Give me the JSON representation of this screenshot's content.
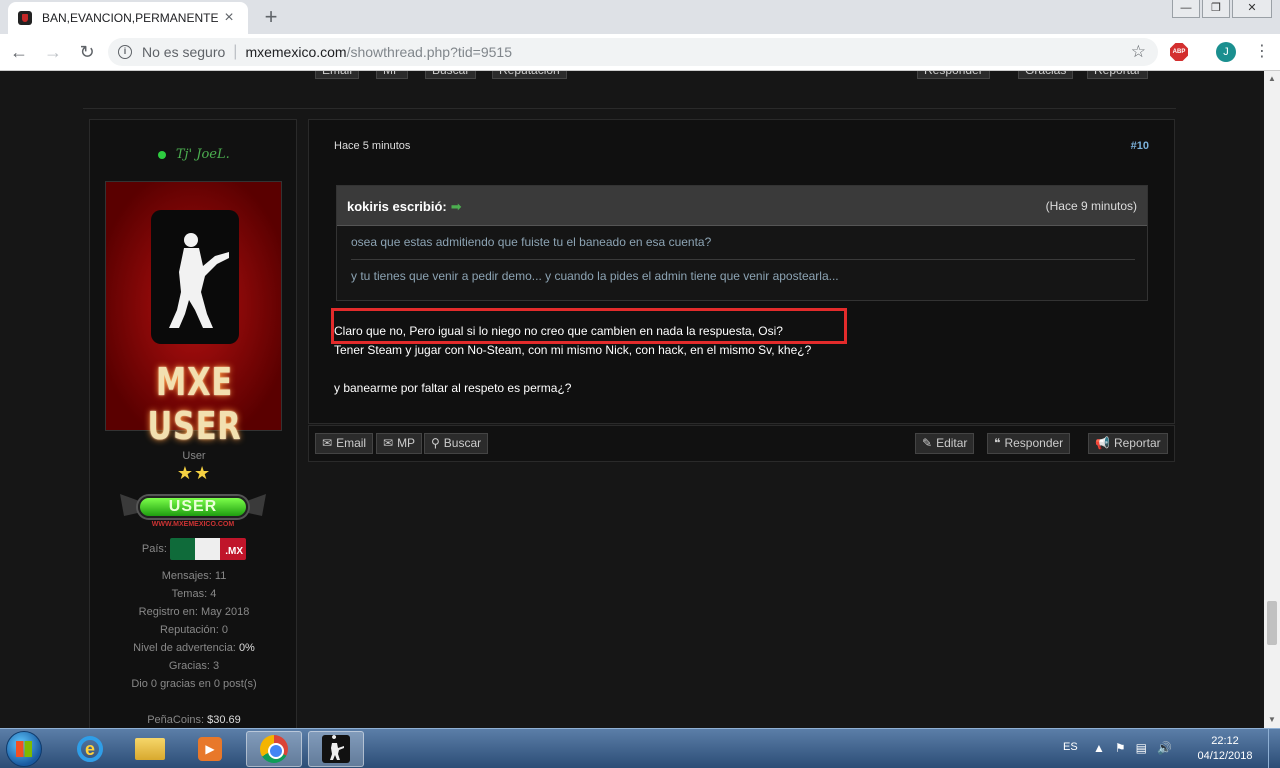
{
  "browser": {
    "tab_title": "BAN,EVANCION,PERMANENTE",
    "tab_close": "×",
    "new_tab": "+",
    "window_controls": {
      "minimize": "—",
      "maximize": "❐",
      "close": "✕"
    },
    "back": "←",
    "forward": "→",
    "reload": "↻",
    "security_label": "No es seguro",
    "url_host": "mxemexico.com",
    "url_path": "/showthread.php?tid=9515",
    "star": "☆",
    "abp_label": "ABP",
    "profile_initial": "J",
    "menu": "⋮"
  },
  "prev_post_buttons": [
    "Email",
    "MP",
    "Buscar",
    "Reputación",
    "Responder",
    "Gracias",
    "Reportar"
  ],
  "user": {
    "name": "Tj' JoeL.",
    "avatar_text": "MXE USER",
    "rank_title": "User",
    "stars": "★★",
    "badge_label": "USER",
    "badge_sub": "WWW.MXEMEXICO.COM",
    "country_label": "País:",
    "country_code": ".MX",
    "stats": [
      {
        "label": "Mensajes:",
        "value": "11"
      },
      {
        "label": "Temas:",
        "value": "4"
      },
      {
        "label": "Registro en:",
        "value": "May 2018"
      },
      {
        "label": "Reputación:",
        "value": "0"
      },
      {
        "label": "Nivel de advertencia:",
        "value": "0%"
      },
      {
        "label": "Gracias:",
        "value": "3"
      },
      {
        "label": "Dio 0 gracias en 0 post(s)",
        "value": ""
      }
    ],
    "coins_label": "PeñaCoins:",
    "coins_value": "$30.69"
  },
  "post": {
    "date": "Hace 5 minutos",
    "number": "#10",
    "quote": {
      "author": "kokiris escribió:",
      "arrow": "➡",
      "time": "(Hace 9 minutos)",
      "lines": [
        "osea que estas admitiendo que fuiste tu el baneado en esa cuenta?",
        "y tu tienes que venir a pedir demo... y cuando la pides el admin tiene que venir apostearla..."
      ]
    },
    "body": [
      "Claro que no, Pero igual si lo niego no creo que cambien en nada la respuesta, Osi?",
      "Tener Steam y jugar con No-Steam, con mi mismo Nick, con hack, en el mismo Sv, khe¿?",
      "y banearme por faltar al respeto es perma¿?"
    ]
  },
  "footer": {
    "email": "Email",
    "pm": "MP",
    "search": "Buscar",
    "edit": "Editar",
    "reply": "Responder",
    "report": "Reportar"
  },
  "taskbar": {
    "language": "ES",
    "time": "22:12",
    "date": "04/12/2018"
  },
  "colors": {
    "page_bg": "#161616",
    "highlight": "#e32b2b",
    "online": "#2ecc40",
    "post_number": "#7ab0d9"
  }
}
